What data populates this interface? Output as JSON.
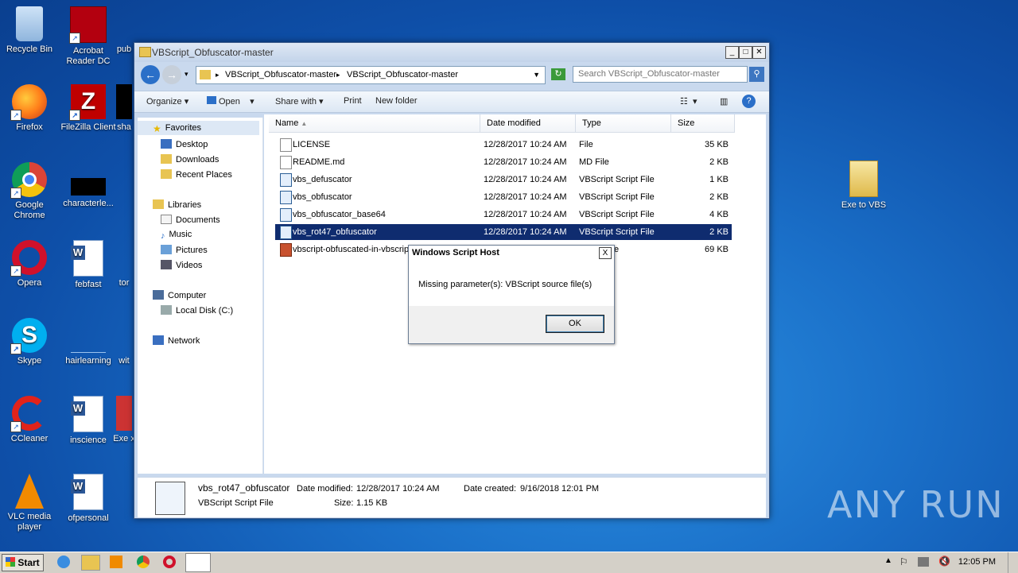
{
  "desktop": {
    "icons": [
      {
        "label": "Recycle Bin"
      },
      {
        "label": "Acrobat Reader DC"
      },
      {
        "label": "pub"
      },
      {
        "label": "Firefox"
      },
      {
        "label": "FileZilla Client"
      },
      {
        "label": "sha"
      },
      {
        "label": "Google Chrome"
      },
      {
        "label": "characterle..."
      },
      {
        "label": "Opera"
      },
      {
        "label": "febfast"
      },
      {
        "label": "tor"
      },
      {
        "label": "Skype"
      },
      {
        "label": "hairlearning"
      },
      {
        "label": "wit"
      },
      {
        "label": "CCleaner"
      },
      {
        "label": "inscience"
      },
      {
        "label": "Exe x"
      },
      {
        "label": "VLC media player"
      },
      {
        "label": "ofpersonal"
      },
      {
        "label": "Exe to VBS"
      }
    ],
    "watermark": "ANY RUN"
  },
  "window": {
    "title": "VBScript_Obfuscator-master",
    "breadcrumb": [
      "VBScript_Obfuscator-master",
      "VBScript_Obfuscator-master"
    ],
    "search_placeholder": "Search VBScript_Obfuscator-master",
    "toolbar": {
      "organize": "Organize",
      "open": "Open",
      "share_with": "Share with",
      "print": "Print",
      "new_folder": "New folder"
    },
    "nav": {
      "favorites": "Favorites",
      "desktop": "Desktop",
      "downloads": "Downloads",
      "recent_places": "Recent Places",
      "libraries": "Libraries",
      "documents": "Documents",
      "music": "Music",
      "pictures": "Pictures",
      "videos": "Videos",
      "computer": "Computer",
      "local_disk": "Local Disk (C:)",
      "network": "Network"
    },
    "columns": {
      "name": "Name",
      "date": "Date modified",
      "type": "Type",
      "size": "Size"
    },
    "files": [
      {
        "name": "LICENSE",
        "date": "12/28/2017 10:24 AM",
        "type": "File",
        "size": "35 KB"
      },
      {
        "name": "README.md",
        "date": "12/28/2017 10:24 AM",
        "type": "MD File",
        "size": "2 KB"
      },
      {
        "name": "vbs_defuscator",
        "date": "12/28/2017 10:24 AM",
        "type": "VBScript Script File",
        "size": "1 KB"
      },
      {
        "name": "vbs_obfuscator",
        "date": "12/28/2017 10:24 AM",
        "type": "VBScript Script File",
        "size": "2 KB"
      },
      {
        "name": "vbs_obfuscator_base64",
        "date": "12/28/2017 10:24 AM",
        "type": "VBScript Script File",
        "size": "4 KB"
      },
      {
        "name": "vbs_rot47_obfuscator",
        "date": "12/28/2017 10:24 AM",
        "type": "VBScript Script File",
        "size": "2 KB"
      },
      {
        "name": "vbscript-obfuscated-in-vbscrip",
        "date": "",
        "type": "e",
        "size": "69 KB"
      }
    ],
    "details": {
      "name": "vbs_rot47_obfuscator",
      "type": "VBScript Script File",
      "date_modified_label": "Date modified:",
      "date_modified": "12/28/2017 10:24 AM",
      "size_label": "Size:",
      "size": "1.15 KB",
      "date_created_label": "Date created:",
      "date_created": "9/16/2018 12:01 PM"
    }
  },
  "dialog": {
    "title": "Windows Script Host",
    "message": "Missing parameter(s): VBScript source file(s)",
    "ok": "OK",
    "close": "X"
  },
  "taskbar": {
    "start": "Start",
    "clock": "12:05 PM"
  }
}
